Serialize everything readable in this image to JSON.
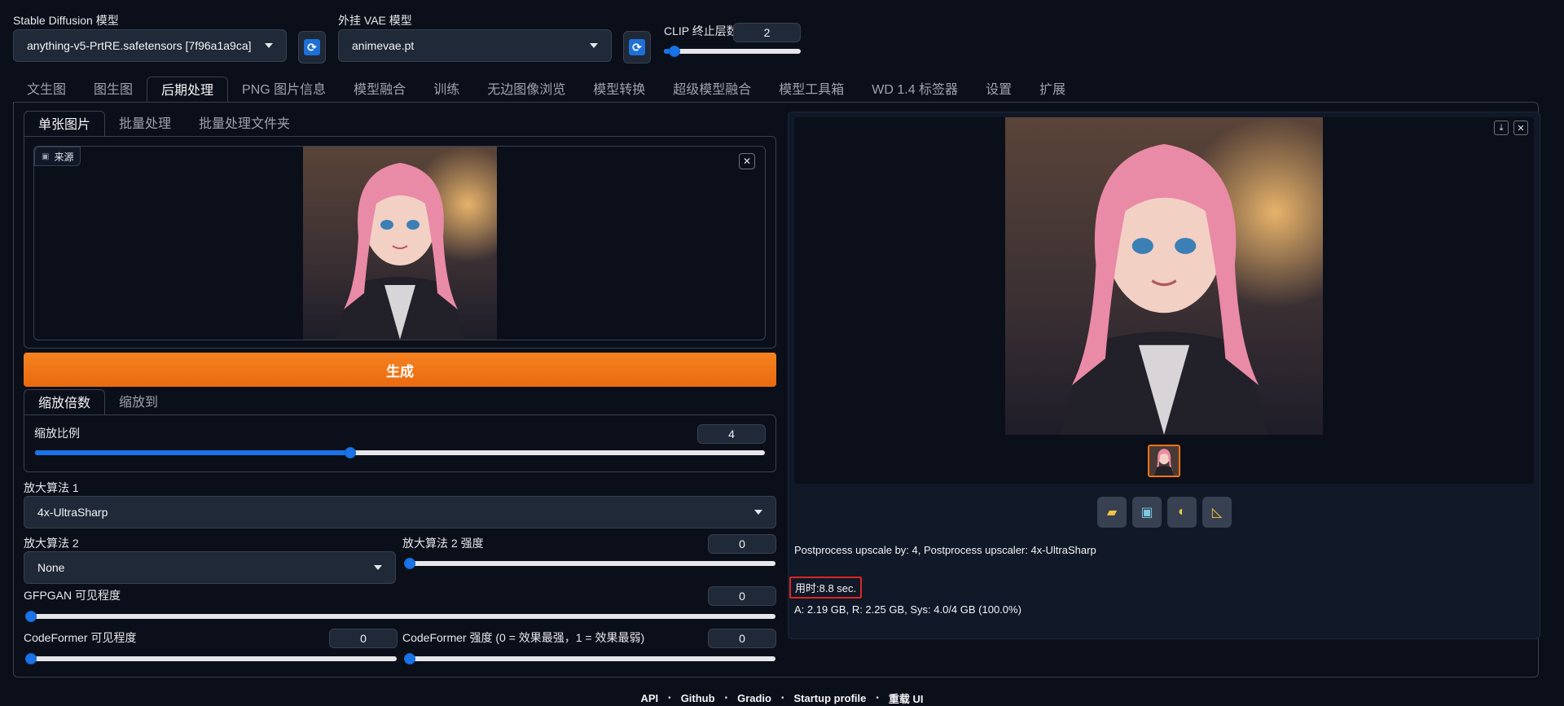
{
  "header": {
    "sd_model_label": "Stable Diffusion 模型",
    "sd_model_value": "anything-v5-PrtRE.safetensors [7f96a1a9ca]",
    "vae_label": "外挂 VAE 模型",
    "vae_value": "animevae.pt",
    "clip_label": "CLIP 终止层数",
    "clip_value": "2",
    "clip_level": 0.08
  },
  "main_tabs": [
    "文生图",
    "图生图",
    "后期处理",
    "PNG 图片信息",
    "模型融合",
    "训练",
    "无边图像浏览",
    "模型转换",
    "超级模型融合",
    "模型工具箱",
    "WD 1.4 标签器",
    "设置",
    "扩展"
  ],
  "active_main_tab": "后期处理",
  "sub_tabs": [
    "单张图片",
    "批量处理",
    "批量处理文件夹"
  ],
  "source_label": "来源",
  "generate_label": "生成",
  "resize_tabs": [
    "缩放倍数",
    "缩放到"
  ],
  "scale": {
    "label": "缩放比例",
    "value": "4",
    "level": 0.432
  },
  "upscaler1": {
    "label": "放大算法 1",
    "value": "4x-UltraSharp"
  },
  "upscaler2": {
    "label": "放大算法 2",
    "value": "None"
  },
  "upscaler2_strength": {
    "label": "放大算法 2 强度",
    "value": "0",
    "level": 0
  },
  "gfpgan": {
    "label": "GFPGAN 可见程度",
    "value": "0",
    "level": 0
  },
  "codeformer_vis": {
    "label": "CodeFormer 可见程度",
    "value": "0",
    "level": 0
  },
  "codeformer_weight": {
    "label": "CodeFormer 强度 (0 = 效果最强，1 = 效果最弱)",
    "value": "0",
    "level": 0
  },
  "output": {
    "info": "Postprocess upscale by: 4, Postprocess upscaler: 4x-UltraSharp",
    "time": "用时:8.8 sec.",
    "mem": "A: 2.19 GB, R: 2.25 GB, Sys: 4.0/4 GB (100.0%)"
  },
  "footer": [
    "API",
    "Github",
    "Gradio",
    "Startup profile",
    "重载 UI"
  ],
  "colors": {
    "accent": "#1a73e8",
    "generate": "#f97316",
    "highlight": "#dc2626"
  }
}
